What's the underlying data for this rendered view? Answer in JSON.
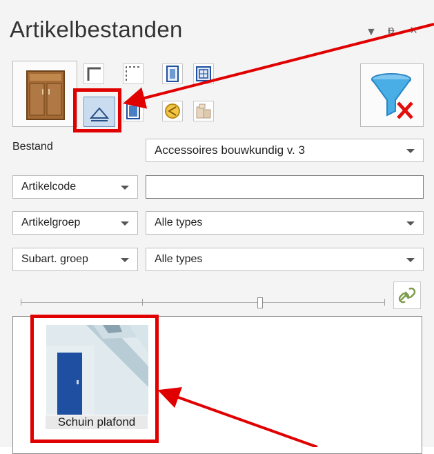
{
  "panel": {
    "title": "Artikelbestanden",
    "controls": {
      "dropdown_icon": "chevron-down-icon",
      "pin_icon": "pin-icon",
      "close_icon": "close-icon"
    }
  },
  "toolbar": {
    "large_icon": "cabinet-icon",
    "filter_icon": "filter-clear-icon",
    "small_icons": [
      "corner-wall-icon",
      "dotted-corner-icon",
      "door-icon",
      "window-grid-icon",
      "slanted-ceiling-icon",
      "door-frame-icon",
      "circle-arrow-icon",
      "boxes-icon"
    ],
    "selected": "slanted-ceiling-icon"
  },
  "filters": {
    "bestand_label": "Bestand",
    "bestand_value": "Accessoires bouwkundig v. 3",
    "artikelcode_label": "Artikelcode",
    "artikelcode_value": "",
    "artikelgroep_label": "Artikelgroep",
    "artikelgroep_value": "Alle types",
    "subart_label": "Subart. groep",
    "subart_value": "Alle types"
  },
  "list": {
    "items": [
      {
        "label": "Schuin plafond"
      }
    ]
  },
  "colors": {
    "highlight": "#e00000",
    "selected_bg": "#c9dcf0",
    "accent_blue": "#1e4fa0"
  }
}
